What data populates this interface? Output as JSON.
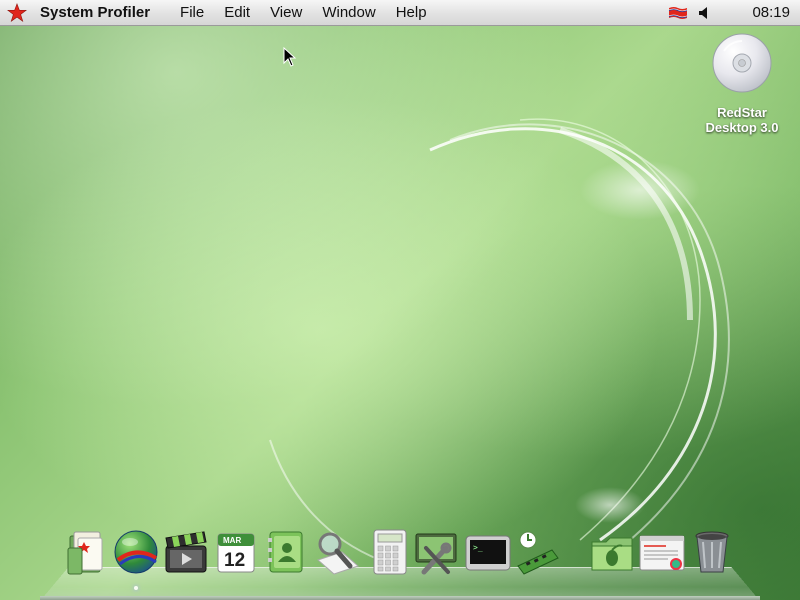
{
  "menubar": {
    "app_name": "System Profiler",
    "menus": [
      {
        "label": "File"
      },
      {
        "label": "Edit"
      },
      {
        "label": "View"
      },
      {
        "label": "Window"
      },
      {
        "label": "Help"
      }
    ],
    "clock": "08:19"
  },
  "desktop": {
    "icon_label_line1": "RedStar",
    "icon_label_line2": "Desktop 3.0"
  },
  "dock": {
    "items": [
      {
        "icon": "documents-folder-icon"
      },
      {
        "icon": "internet-browser-icon"
      },
      {
        "icon": "movie-player-icon"
      },
      {
        "icon": "calendar-icon",
        "month": "MAR",
        "day": "12"
      },
      {
        "icon": "address-book-icon"
      },
      {
        "icon": "search-icon"
      },
      {
        "icon": "calculator-icon"
      },
      {
        "icon": "system-preferences-icon"
      },
      {
        "icon": "terminal-icon"
      },
      {
        "icon": "system-monitor-icon"
      },
      {
        "icon": "application-folder-icon"
      },
      {
        "icon": "document-viewer-icon"
      },
      {
        "icon": "trash-icon"
      }
    ]
  },
  "colors": {
    "accent_star": "#e0261c",
    "flag_red": "#e0261c",
    "desktop_green": "#8cc473"
  }
}
